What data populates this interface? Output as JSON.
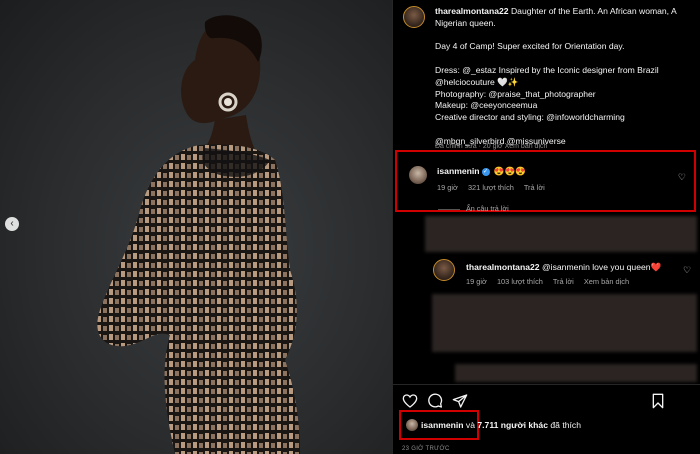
{
  "post": {
    "author": "tharealmontana22",
    "caption_first": "Daughter of the Earth. An African woman, A Nigerian queen.",
    "caption_p2": "Day 4 of Camp! Super excited for Orientation day.",
    "caption_p3": "Dress: @_estaz Inspired by the Iconic designer from Brazil @helciocouture 🤍✨\nPhotography: @praise_that_photographer\nMakeup: @ceeyonceemua\nCreative director and styling: @infoworldcharming",
    "caption_p4": "@mbgn_silverbird @missuniverse",
    "caption_meta": "Đã chỉnh sửa · 20 giờ    Xem bản dịch"
  },
  "comment": {
    "user": "isanmenin",
    "text": "😍😍😍",
    "time": "19 giờ",
    "likes": "321 lượt thích",
    "reply_label": "Trả lời",
    "hide_replies": "Ẩn câu trả lời"
  },
  "reply": {
    "user": "tharealmontana22",
    "text": "@isanmenin love you queen❤️",
    "time": "19 giờ",
    "likes": "103 lượt thích",
    "reply_label": "Trả lời",
    "translate_label": "Xem bản dịch"
  },
  "likes_line": {
    "user": "isanmenin",
    "connector": "và",
    "others": "7.711 người khác",
    "suffix": "đã thích"
  },
  "time_ago": "23 GIỜ TRƯỚC",
  "icons": [
    "chevron-left-icon",
    "heart-icon",
    "comment-icon",
    "share-icon",
    "bookmark-icon",
    "verified-icon"
  ]
}
